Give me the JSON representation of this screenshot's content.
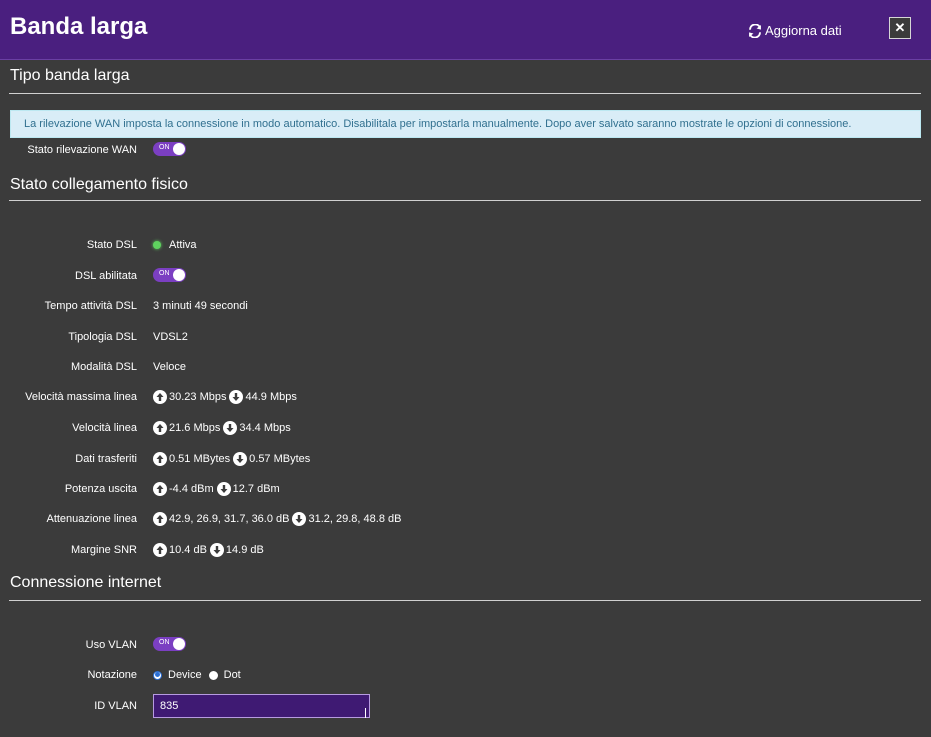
{
  "header": {
    "title": "Banda larga",
    "refresh_label": "Aggiorna dati",
    "close_symbol": "✕"
  },
  "wan_section": {
    "title": "Tipo banda larga",
    "info_text": "La rilevazione WAN imposta la connessione in modo automatico. Disabilitala per impostarla manualmente. Dopo aver salvato saranno mostrate le opzioni di connessione.",
    "detection_label": "Stato rilevazione WAN",
    "detection_toggle": "ON"
  },
  "physical_section": {
    "title": "Stato collegamento fisico",
    "dsl_status_label": "Stato DSL",
    "dsl_status_value": "Attiva",
    "dsl_enabled_label": "DSL abilitata",
    "dsl_enabled_toggle": "ON",
    "uptime_label": "Tempo attività DSL",
    "uptime_value": "3 minuti 49 secondi",
    "type_label": "Tipologia DSL",
    "type_value": "VDSL2",
    "mode_label": "Modalità DSL",
    "mode_value": "Veloce",
    "max_speed_label": "Velocità massima linea",
    "max_speed_up": "30.23 Mbps",
    "max_speed_down": "44.9 Mbps",
    "speed_label": "Velocità linea",
    "speed_up": "21.6 Mbps",
    "speed_down": "34.4 Mbps",
    "data_label": "Dati trasferiti",
    "data_up": "0.51 MBytes",
    "data_down": "0.57 MBytes",
    "power_label": "Potenza uscita",
    "power_up": "-4.4 dBm",
    "power_down": "12.7 dBm",
    "attenuation_label": "Attenuazione linea",
    "attenuation_up": "42.9, 26.9, 31.7, 36.0 dB",
    "attenuation_down": "31.2, 29.8, 48.8 dB",
    "snr_label": "Margine SNR",
    "snr_up": "10.4 dB",
    "snr_down": "14.9 dB"
  },
  "internet_section": {
    "title": "Connessione internet",
    "vlan_label": "Uso VLAN",
    "vlan_toggle": "ON",
    "notation_label": "Notazione",
    "notation_options": [
      "Device",
      "Dot"
    ],
    "notation_selected": "Device",
    "vlan_id_label": "ID VLAN",
    "vlan_id_value": "835"
  },
  "colors": {
    "header_bg": "#4a1f7f",
    "page_bg": "#3b3b3b",
    "accent": "#7b3fc2",
    "info_bg": "#d9edf7",
    "info_text": "#31708f",
    "status_led": "#5fd35f"
  }
}
